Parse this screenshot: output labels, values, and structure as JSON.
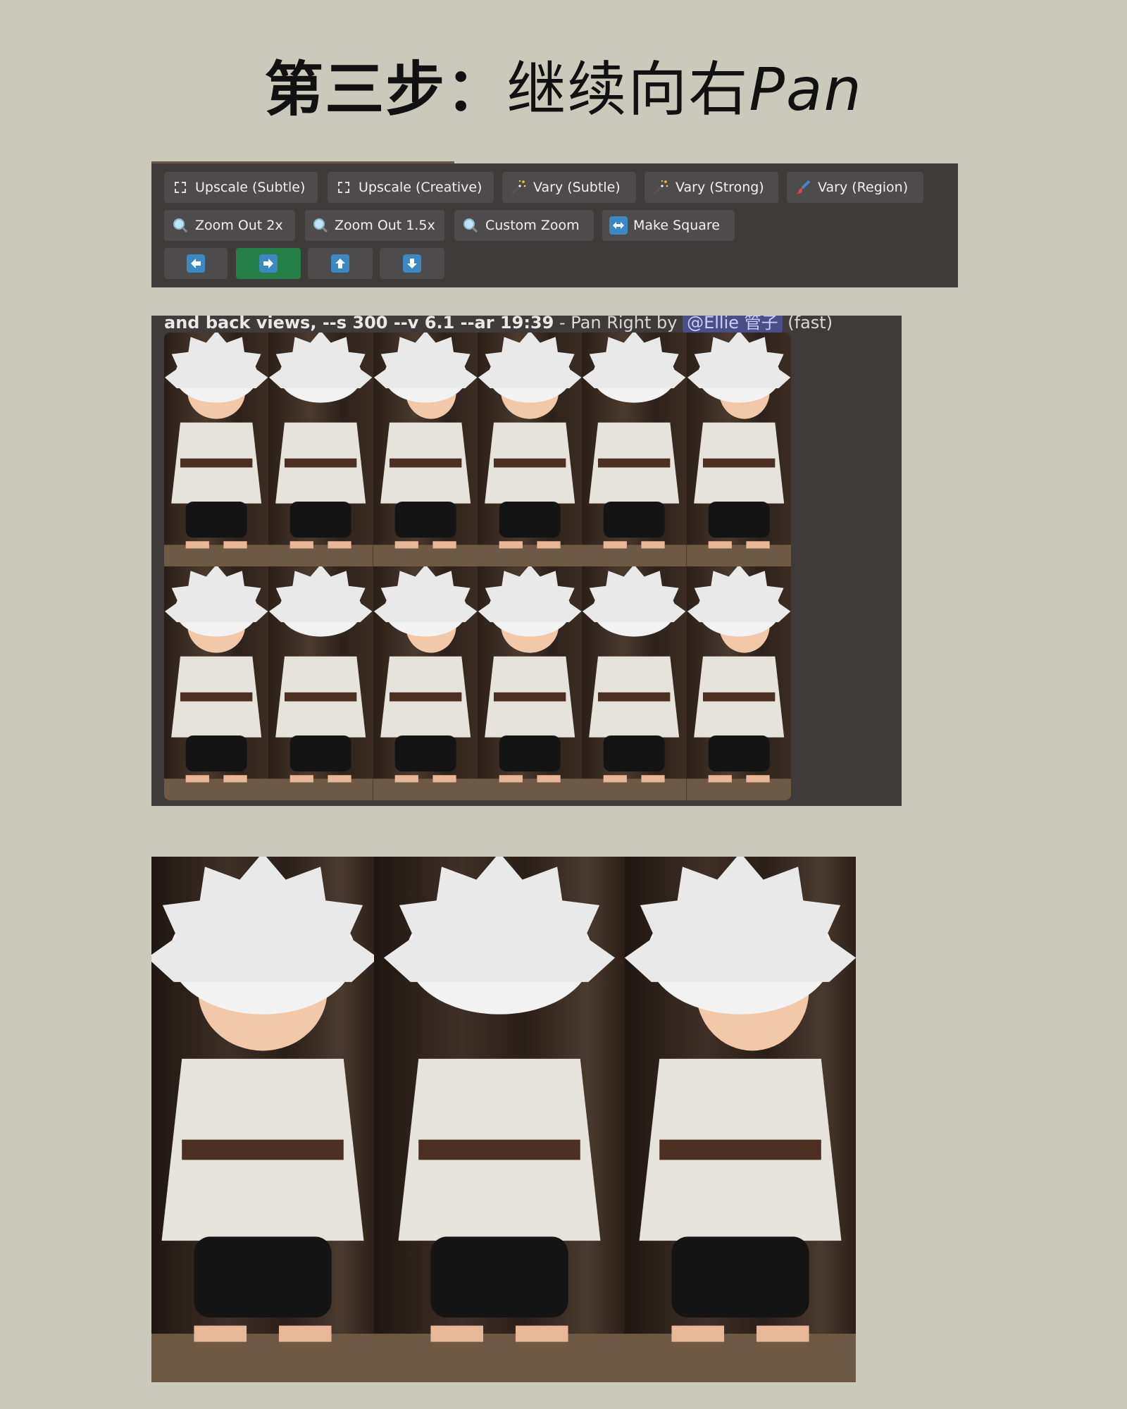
{
  "title": {
    "bold": "第三步：",
    "light": "继续向右",
    "italic": "Pan"
  },
  "buttons_row1": [
    {
      "label": "Upscale (Subtle)",
      "icon": "upscale-icon"
    },
    {
      "label": "Upscale (Creative)",
      "icon": "upscale-icon"
    },
    {
      "label": "Vary (Subtle)",
      "icon": "magic-wand-icon"
    },
    {
      "label": "Vary (Strong)",
      "icon": "magic-wand-icon"
    },
    {
      "label": "Vary (Region)",
      "icon": "paintbrush-icon"
    }
  ],
  "buttons_row2": [
    {
      "label": "Zoom Out 2x",
      "icon": "magnifier-icon"
    },
    {
      "label": "Zoom Out 1.5x",
      "icon": "magnifier-icon"
    },
    {
      "label": "Custom Zoom",
      "icon": "magnifier-icon"
    },
    {
      "label": "Make Square",
      "icon": "left-right-arrow-icon"
    }
  ],
  "pan_buttons": [
    {
      "direction": "left",
      "icon": "arrow-left-icon",
      "active": false
    },
    {
      "direction": "right",
      "icon": "arrow-right-icon",
      "active": true
    },
    {
      "direction": "up",
      "icon": "arrow-up-icon",
      "active": false
    },
    {
      "direction": "down",
      "icon": "arrow-down-icon",
      "active": false
    }
  ],
  "message": {
    "prompt_tail": "and back views, --s 300 --v 6.1 --ar 19:39",
    "action": " - Pan Right by ",
    "mention": "@Ellie 管子",
    "speed": " (fast)"
  },
  "colors": {
    "background": "#cbc8bc",
    "panel": "#3f3b3b",
    "button": "#4e4b4c",
    "active_button": "#248046",
    "arrow_icon": "#3b88c3"
  }
}
